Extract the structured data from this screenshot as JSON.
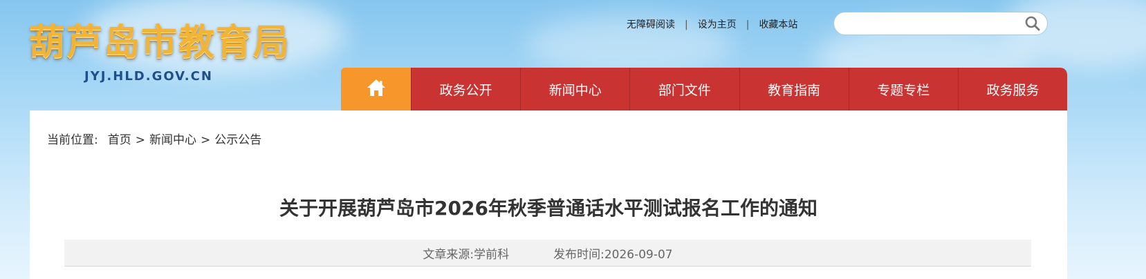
{
  "site": {
    "title": "葫芦岛市教育局",
    "domain": "JYJ.HLD.GOV.CN"
  },
  "toplinks": [
    {
      "label": "无障碍阅读"
    },
    {
      "label": "设为主页"
    },
    {
      "label": "收藏本站"
    }
  ],
  "toplinks_separator": "|",
  "search": {
    "placeholder": "",
    "value": "",
    "icon": "search-icon"
  },
  "nav": {
    "home_icon": "home-icon",
    "items": [
      {
        "label": "政务公开"
      },
      {
        "label": "新闻中心"
      },
      {
        "label": "部门文件"
      },
      {
        "label": "教育指南"
      },
      {
        "label": "专题专栏"
      },
      {
        "label": "政务服务"
      }
    ]
  },
  "breadcrumb": {
    "label": "当前位置:",
    "separator": ">",
    "items": [
      "首页",
      "新闻中心",
      "公示公告"
    ]
  },
  "article": {
    "title": "关于开展葫芦岛市2026年秋季普通话水平测试报名工作的通知",
    "source": "文章来源:学前科",
    "date": "发布时间:2026-09-07"
  },
  "colors": {
    "nav_red": "#c93432",
    "nav_home_orange": "#f6962b",
    "logo_gold": "#f2b437",
    "domain_blue": "#1e4f8b"
  }
}
